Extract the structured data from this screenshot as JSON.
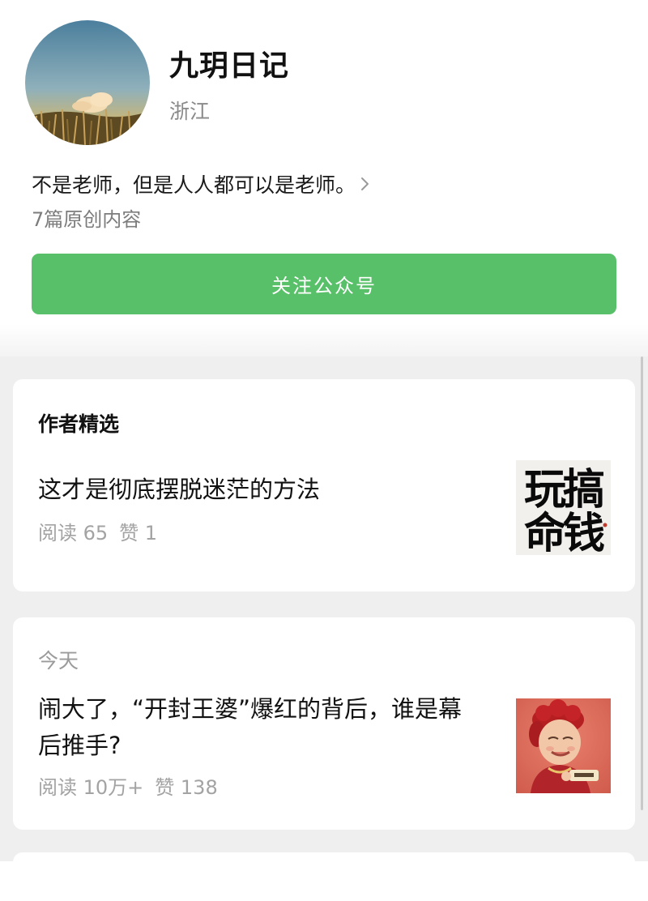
{
  "profile": {
    "name": "九玥日记",
    "location": "浙江",
    "bio": "不是老师，但是人人都可以是老师。",
    "original_count": "7篇原创内容",
    "follow_label": "关注公众号"
  },
  "featured": {
    "section_title": "作者精选",
    "article": {
      "title": "这才是彻底摆脱迷茫的方法",
      "reads": "阅读 65",
      "likes": "赞 1",
      "thumbnail_text_line1": "玩搞",
      "thumbnail_text_line2": "命钱"
    }
  },
  "today": {
    "date_label": "今天",
    "article": {
      "title": "闹大了，“开封王婆”爆红的背后，谁是幕后推手?",
      "reads": "阅读 10万+",
      "likes": "赞 138"
    }
  },
  "colors": {
    "accent_green": "#59c06a",
    "feed_background": "#efefef"
  },
  "icons": {
    "bio_more": "chevron-right-icon"
  }
}
